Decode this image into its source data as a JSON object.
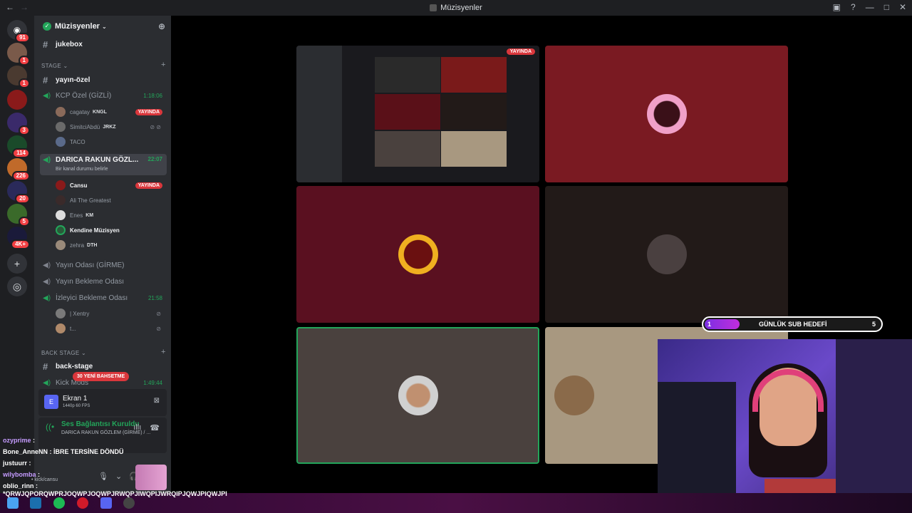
{
  "window": {
    "title": "Müzisyenler"
  },
  "guild": {
    "name": "Müzisyenler"
  },
  "server_badges": [
    "91",
    "1",
    "1",
    "3",
    "114",
    "226",
    "20",
    "5",
    "4K+"
  ],
  "categories": {
    "stage": "STAGE",
    "back_stage": "BACK STAGE"
  },
  "channels": {
    "jukebox": "jukebox",
    "yayin_ozel": "yayın-özel",
    "kcp": {
      "name": "KCP Özel (GİZLİ)",
      "time": "1:18:06"
    },
    "darica": {
      "name": "DARICA RAKUN GÖZL...",
      "time": "22:07",
      "status": "Bir kanal durumu belirle"
    },
    "yayin_odasi": "Yayın Odası (GİRME)",
    "yayin_bekleme": "Yayın Bekleme Odası",
    "izleyici": {
      "name": "İzleyici Bekleme Odası",
      "time": "21:58"
    },
    "back_stage": "back-stage",
    "kick_mods": {
      "name": "Kick Mods",
      "time": "1:49:44"
    }
  },
  "kcp_users": [
    {
      "name": "cagatay",
      "tag": "KNGL",
      "live": "YAYINDA"
    },
    {
      "name": "SimitciAbdü",
      "tag": "JRKZ"
    },
    {
      "name": "TACO"
    }
  ],
  "darica_users": [
    {
      "name": "Cansu",
      "live": "YAYINDA"
    },
    {
      "name": "Ali The Greatest"
    },
    {
      "name": "Enes",
      "tag": "KM"
    },
    {
      "name": "Kendine Müzisyen"
    },
    {
      "name": "zehra",
      "tag": "DTH"
    }
  ],
  "izleyici_users": [
    {
      "name": "| Xentry"
    },
    {
      "name": "t..."
    }
  ],
  "mention_alert": "30 YENİ BAHSETME",
  "screen_share": {
    "name": "Ekran 1",
    "quality": "1440p 60 FPS"
  },
  "voice": {
    "status": "Ses Bağlantısı Kuruldu",
    "channel": "DARICA RAKUN GÖZLEM (GİRME) / ..."
  },
  "user_panel": {
    "sub": "• kick/cansu"
  },
  "stream_tile": {
    "badge": "YAYINDA"
  },
  "sub_goal": {
    "current": "1",
    "label": "GÜNLÜK SUB HEDEFİ",
    "target": "5",
    "progress": 0.2
  },
  "chat": [
    {
      "user": "ozyprime",
      "msg": ":"
    },
    {
      "user": "Bone_AnneNN",
      "msg": ": İBRE TERSİNE DÖNDÜ"
    },
    {
      "user": "justuurr",
      "msg": ":"
    },
    {
      "user": "wilybomba",
      "msg": ":"
    },
    {
      "user": "oblio_rinn",
      "msg": ":"
    }
  ],
  "ticker": "*QRWJQPORQWPRJOQWPJOQWPJRWQPJIWQPIJWRQIPJQWJPIQWJPI",
  "colors": {
    "green": "#23a55a",
    "red": "#da373c",
    "blurple": "#5865f2",
    "bg": "#2b2d31"
  }
}
